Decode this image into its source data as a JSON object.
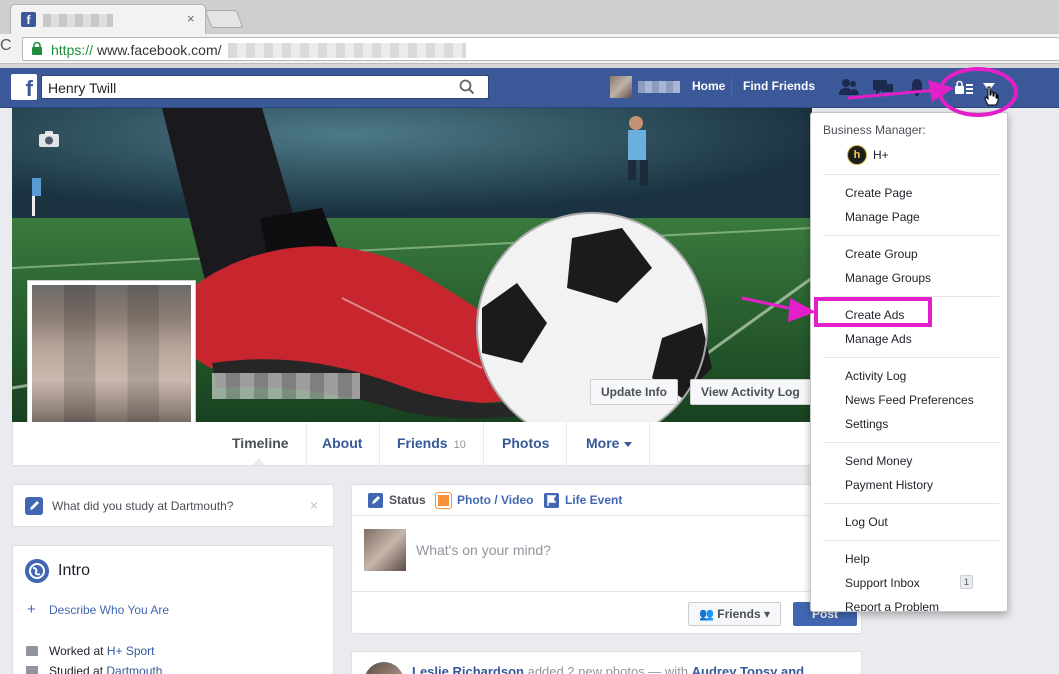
{
  "browser": {
    "tab_close": "×",
    "url_scheme": "https://",
    "url_host": "www.facebook.com/"
  },
  "topbar": {
    "logo": "f",
    "search_value": "Henry Twill",
    "nav_home": "Home",
    "nav_find_friends": "Find Friends",
    "brand_color": "#3b5998"
  },
  "cover": {
    "update_info": "Update Info",
    "view_activity_log": "View Activity Log"
  },
  "timeline_nav": {
    "timeline": "Timeline",
    "about": "About",
    "friends": "Friends",
    "friends_count": "10",
    "photos": "Photos",
    "more": "More"
  },
  "left": {
    "study_prompt": "What did you study at Dartmouth?",
    "study_close": "×",
    "intro_title": "Intro",
    "describe_plus": "+",
    "describe_link": "Describe Who You Are",
    "worked_at_prefix": "Worked at ",
    "worked_at_place": "H+ Sport",
    "studied_at_prefix": "Studied at ",
    "studied_at_place": "Dartmouth"
  },
  "composer": {
    "tab_status": "Status",
    "tab_photo": "Photo / Video",
    "tab_life": "Life Event",
    "placeholder": "What's on your mind?",
    "audience": "Friends",
    "post": "Post"
  },
  "feed": {
    "author": "Leslie Richardson",
    "action": " added 2 new photos — with ",
    "tagged": "Audrey Topsy and"
  },
  "dropdown": {
    "business_manager_label": "Business Manager:",
    "business_avatar_letter": "h",
    "business_name": "H+",
    "create_page": "Create Page",
    "manage_page": "Manage Page",
    "create_group": "Create Group",
    "manage_groups": "Manage Groups",
    "create_ads": "Create Ads",
    "manage_ads": "Manage Ads",
    "activity_log": "Activity Log",
    "news_feed_preferences": "News Feed Preferences",
    "settings": "Settings",
    "send_money": "Send Money",
    "payment_history": "Payment History",
    "log_out": "Log Out",
    "help": "Help",
    "support_inbox": "Support Inbox",
    "support_inbox_count": "1",
    "report_problem": "Report a Problem"
  },
  "annotation_color": "#e21fc8"
}
